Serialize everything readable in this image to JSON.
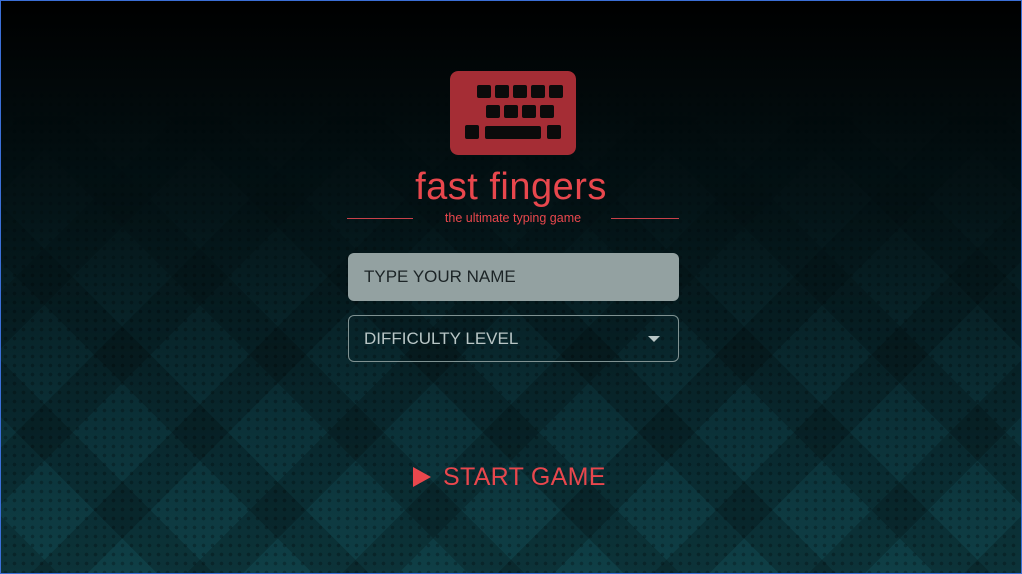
{
  "app": {
    "title": "fast fingers",
    "tagline": "the ultimate typing game"
  },
  "logo": {
    "icon": "keyboard-icon",
    "color": "#a52d35"
  },
  "form": {
    "name_placeholder": "TYPE YOUR NAME",
    "name_value": "",
    "difficulty_label": "DIFFICULTY LEVEL"
  },
  "actions": {
    "start_label": "START GAME",
    "start_icon": "play-icon"
  },
  "colors": {
    "accent": "#e8474d",
    "input_bg": "#93a1a1",
    "background_top": "#000000",
    "background_bottom": "#0f3f46"
  }
}
